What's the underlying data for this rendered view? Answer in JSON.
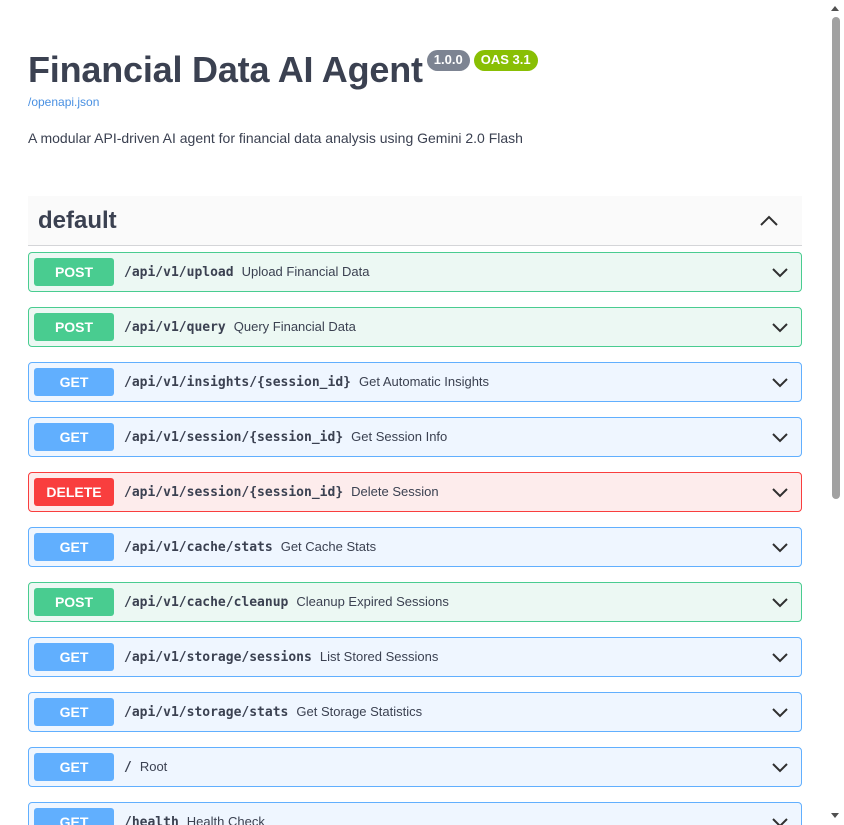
{
  "info": {
    "title": "Financial Data AI Agent",
    "version": "1.0.0",
    "oas_version": "OAS 3.1",
    "spec_link": "/openapi.json",
    "description": "A modular API-driven AI agent for financial data analysis using Gemini 2.0 Flash"
  },
  "tag": {
    "name": "default",
    "toggle_icon": "chevron-up-icon"
  },
  "operations": [
    {
      "method": "POST",
      "path": "/api/v1/upload",
      "summary": "Upload Financial Data"
    },
    {
      "method": "POST",
      "path": "/api/v1/query",
      "summary": "Query Financial Data"
    },
    {
      "method": "GET",
      "path": "/api/v1/insights/{session_id}",
      "summary": "Get Automatic Insights"
    },
    {
      "method": "GET",
      "path": "/api/v1/session/{session_id}",
      "summary": "Get Session Info"
    },
    {
      "method": "DELETE",
      "path": "/api/v1/session/{session_id}",
      "summary": "Delete Session"
    },
    {
      "method": "GET",
      "path": "/api/v1/cache/stats",
      "summary": "Get Cache Stats"
    },
    {
      "method": "POST",
      "path": "/api/v1/cache/cleanup",
      "summary": "Cleanup Expired Sessions"
    },
    {
      "method": "GET",
      "path": "/api/v1/storage/sessions",
      "summary": "List Stored Sessions"
    },
    {
      "method": "GET",
      "path": "/api/v1/storage/stats",
      "summary": "Get Storage Statistics"
    },
    {
      "method": "GET",
      "path": "/",
      "summary": "Root"
    },
    {
      "method": "GET",
      "path": "/health",
      "summary": "Health Check"
    }
  ],
  "colors": {
    "post": "#49cc90",
    "get": "#61affe",
    "delete": "#f93e3e",
    "version_badge": "#7d8492",
    "oas_badge": "#89bf04",
    "link": "#4990e2"
  },
  "icons": {
    "operation_toggle": "chevron-down-icon"
  }
}
